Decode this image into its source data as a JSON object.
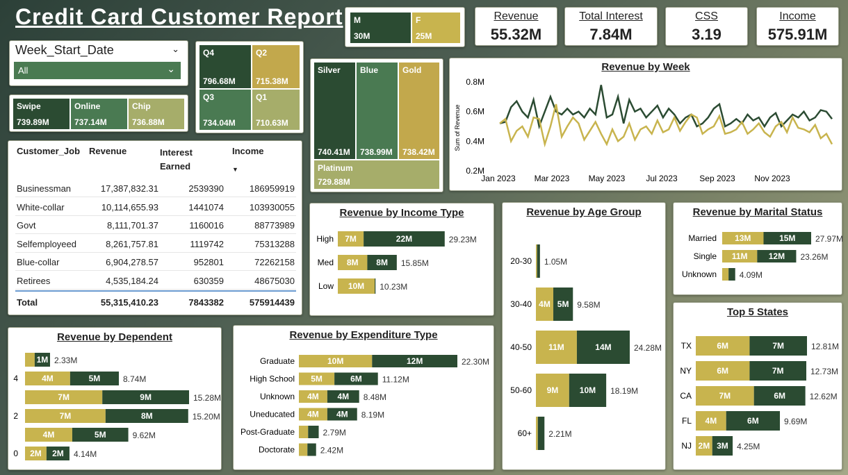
{
  "title": "Credit Card Customer Report",
  "colors": {
    "gold": "#c8b44e",
    "dark": "#2b4b32",
    "mid": "#4a7a52",
    "light": "#a6ad6a",
    "gold2": "#c2a84c"
  },
  "gender": [
    {
      "label": "M",
      "value": "30M"
    },
    {
      "label": "F",
      "value": "25M"
    }
  ],
  "kpis": [
    {
      "label": "Revenue",
      "value": "55.32M"
    },
    {
      "label": "Total Interest",
      "value": "7.84M"
    },
    {
      "label": "CSS",
      "value": "3.19"
    },
    {
      "label": "Income",
      "value": "575.91M"
    }
  ],
  "slicer": {
    "label": "Week_Start_Date",
    "value": "All"
  },
  "payment": [
    {
      "label": "Swipe",
      "value": "739.89M"
    },
    {
      "label": "Online",
      "value": "737.14M"
    },
    {
      "label": "Chip",
      "value": "736.88M"
    }
  ],
  "quarters": [
    {
      "label": "Q4",
      "value": "796.68M"
    },
    {
      "label": "Q2",
      "value": "715.38M"
    },
    {
      "label": "Q3",
      "value": "734.04M"
    },
    {
      "label": "Q1",
      "value": "710.63M"
    }
  ],
  "cards": [
    {
      "label": "Silver",
      "value": "740.41M"
    },
    {
      "label": "Blue",
      "value": "738.99M"
    },
    {
      "label": "Gold",
      "value": "738.42M"
    },
    {
      "label": "Platinum",
      "value": "729.88M"
    }
  ],
  "table": {
    "headers": [
      "Customer_Job",
      "Revenue",
      "Interest Earned",
      "Income"
    ],
    "sort_icon": "sort-descending-icon",
    "rows": [
      [
        "Businessman",
        "17,387,832.31",
        "2539390",
        "186959919"
      ],
      [
        "White-collar",
        "10,114,655.93",
        "1441074",
        "103930055"
      ],
      [
        "Govt",
        "8,111,701.37",
        "1160016",
        "88773989"
      ],
      [
        "Selfemployeed",
        "8,261,757.81",
        "1119742",
        "75313288"
      ],
      [
        "Blue-collar",
        "6,904,278.57",
        "952801",
        "72262158"
      ],
      [
        "Retirees",
        "4,535,184.24",
        "630359",
        "48675030"
      ]
    ],
    "total": [
      "Total",
      "55,315,410.23",
      "7843382",
      "575914439"
    ]
  },
  "chart_data": [
    {
      "type": "line",
      "title": "Revenue by Week",
      "ylabel": "Sum of Revenue",
      "ylim": [
        0.2,
        0.8
      ],
      "yticks": [
        "0.8M",
        "0.6M",
        "0.4M",
        "0.2M"
      ],
      "xticks": [
        "Jan 2023",
        "Mar 2023",
        "May 2023",
        "Jul 2023",
        "Sep 2023",
        "Nov 2023"
      ],
      "series": [
        {
          "values": [
            0.52,
            0.53,
            0.63,
            0.67,
            0.6,
            0.56,
            0.68,
            0.5,
            0.6,
            0.7,
            0.6,
            0.58,
            0.62,
            0.58,
            0.6,
            0.56,
            0.62,
            0.58,
            0.78,
            0.56,
            0.58,
            0.7,
            0.52,
            0.68,
            0.6,
            0.62,
            0.56,
            0.6,
            0.64,
            0.56,
            0.62,
            0.58,
            0.52,
            0.56,
            0.58,
            0.5,
            0.52,
            0.56,
            0.62,
            0.65,
            0.5,
            0.52,
            0.55,
            0.52,
            0.58,
            0.54,
            0.56,
            0.5,
            0.56,
            0.59,
            0.5,
            0.54,
            0.58,
            0.56,
            0.6,
            0.54,
            0.56,
            0.61,
            0.6,
            0.55
          ]
        },
        {
          "values": [
            0.52,
            0.55,
            0.4,
            0.47,
            0.5,
            0.43,
            0.56,
            0.55,
            0.38,
            0.5,
            0.65,
            0.43,
            0.5,
            0.56,
            0.52,
            0.41,
            0.47,
            0.53,
            0.45,
            0.38,
            0.48,
            0.4,
            0.43,
            0.52,
            0.41,
            0.48,
            0.5,
            0.45,
            0.54,
            0.46,
            0.48,
            0.56,
            0.47,
            0.53,
            0.58,
            0.56,
            0.45,
            0.48,
            0.5,
            0.57,
            0.45,
            0.46,
            0.48,
            0.53,
            0.45,
            0.48,
            0.52,
            0.46,
            0.43,
            0.5,
            0.53,
            0.46,
            0.56,
            0.49,
            0.48,
            0.46,
            0.51,
            0.42,
            0.45,
            0.38
          ]
        }
      ]
    },
    {
      "type": "bar",
      "title": "Revenue by Income Type",
      "categories": [
        "High",
        "Med",
        "Low"
      ],
      "series": [
        {
          "values": [
            7,
            8,
            10
          ]
        },
        {
          "values": [
            22,
            8,
            0.23
          ]
        }
      ],
      "segment_labels": [
        [
          "7M",
          "22M"
        ],
        [
          "8M",
          "8M"
        ],
        [
          "10M",
          ""
        ]
      ],
      "totals": [
        "29.23M",
        "15.85M",
        "10.23M"
      ],
      "max": 29.23
    },
    {
      "type": "bar",
      "title": "Revenue by Age Group",
      "categories": [
        "20-30",
        "30-40",
        "40-50",
        "50-60",
        "60+"
      ],
      "series": [
        {
          "values": [
            0.3,
            4.5,
            10.6,
            8.6,
            0.5
          ]
        },
        {
          "values": [
            0.75,
            5.08,
            13.68,
            9.59,
            1.71
          ]
        }
      ],
      "segment_labels": [
        [
          "",
          ""
        ],
        [
          "4M",
          "5M"
        ],
        [
          "11M",
          "14M"
        ],
        [
          "9M",
          "10M"
        ],
        [
          "",
          ""
        ]
      ],
      "totals": [
        "1.05M",
        "9.58M",
        "24.28M",
        "18.19M",
        "2.21M"
      ],
      "max": 24.28
    },
    {
      "type": "bar",
      "title": "Revenue by Marital Status",
      "categories": [
        "Married",
        "Single",
        "Unknown"
      ],
      "series": [
        {
          "values": [
            13,
            11,
            2
          ]
        },
        {
          "values": [
            14.97,
            12.26,
            2.09
          ]
        }
      ],
      "segment_labels": [
        [
          "13M",
          "15M"
        ],
        [
          "11M",
          "12M"
        ],
        [
          "",
          ""
        ]
      ],
      "totals": [
        "27.97M",
        "23.26M",
        "4.09M"
      ],
      "max": 27.97
    },
    {
      "type": "bar",
      "title": "Top 5 States",
      "categories": [
        "TX",
        "NY",
        "CA",
        "FL",
        "NJ"
      ],
      "series": [
        {
          "values": [
            6.2,
            6.2,
            6.7,
            3.5,
            1.9
          ]
        },
        {
          "values": [
            6.61,
            6.53,
            5.92,
            6.19,
            2.35
          ]
        }
      ],
      "segment_labels": [
        [
          "6M",
          "7M"
        ],
        [
          "6M",
          "7M"
        ],
        [
          "7M",
          "6M"
        ],
        [
          "4M",
          "6M"
        ],
        [
          "2M",
          "3M"
        ]
      ],
      "totals": [
        "12.81M",
        "12.73M",
        "12.62M",
        "9.69M",
        "4.25M"
      ],
      "max": 12.81
    },
    {
      "type": "bar",
      "title": "Revenue by Dependent",
      "categories": [
        "",
        "4",
        "",
        "2",
        "",
        "0"
      ],
      "series": [
        {
          "values": [
            0.9,
            4.2,
            7.2,
            7.5,
            4.4,
            2.0
          ]
        },
        {
          "values": [
            1.43,
            4.54,
            8.08,
            7.7,
            5.22,
            2.14
          ]
        }
      ],
      "segment_labels": [
        [
          "",
          "1M"
        ],
        [
          "4M",
          "5M"
        ],
        [
          "7M",
          "9M"
        ],
        [
          "7M",
          "8M"
        ],
        [
          "4M",
          "5M"
        ],
        [
          "2M",
          "2M"
        ]
      ],
      "totals": [
        "2.33M",
        "8.74M",
        "15.28M",
        "15.20M",
        "9.62M",
        "4.14M"
      ],
      "max": 15.28
    },
    {
      "type": "bar",
      "title": "Revenue by Expenditure Type",
      "categories": [
        "Graduate",
        "High School",
        "Unknown",
        "Uneducated",
        "Post-Graduate",
        "Doctorate"
      ],
      "series": [
        {
          "values": [
            10.3,
            5.0,
            4.0,
            4.0,
            1.3,
            1.2
          ]
        },
        {
          "values": [
            12.0,
            6.12,
            4.48,
            4.19,
            1.49,
            1.22
          ]
        }
      ],
      "segment_labels": [
        [
          "10M",
          "12M"
        ],
        [
          "5M",
          "6M"
        ],
        [
          "4M",
          "4M"
        ],
        [
          "4M",
          "4M"
        ],
        [
          "",
          ""
        ],
        [
          "",
          ""
        ]
      ],
      "totals": [
        "22.30M",
        "11.12M",
        "8.48M",
        "8.19M",
        "2.79M",
        "2.42M"
      ],
      "max": 22.3
    }
  ]
}
